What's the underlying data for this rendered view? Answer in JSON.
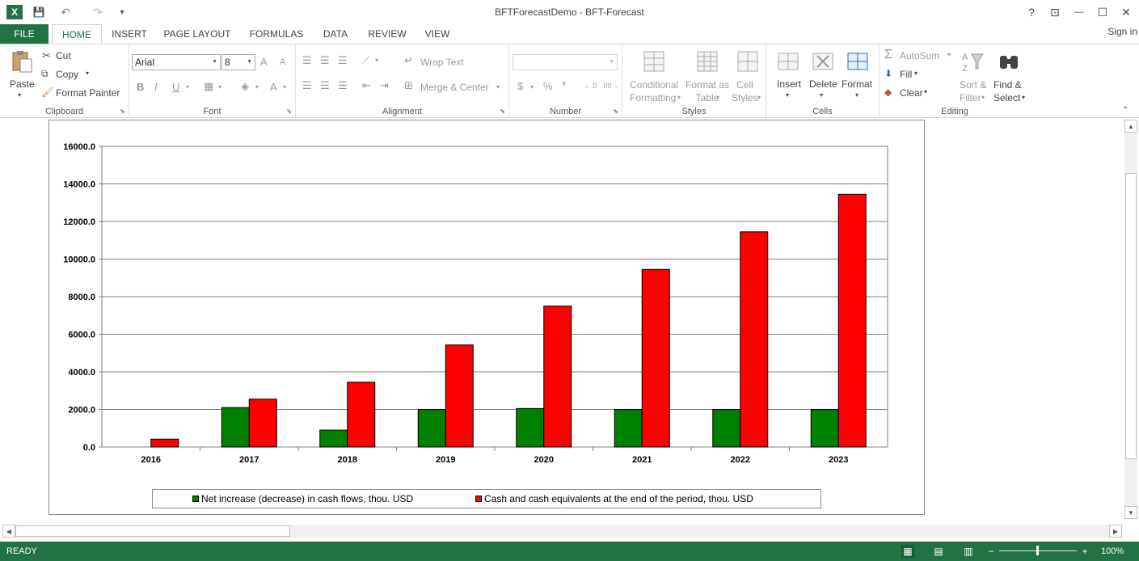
{
  "window": {
    "title": "BFTForecastDemo - BFT-Forecast",
    "help": "?",
    "ribbon_display": "⊡",
    "minimize": "—",
    "restore": "☐",
    "close": "✕"
  },
  "qat": {
    "excel": "X",
    "save": "💾",
    "undo": "↶",
    "redo": "↷",
    "customize": "▾"
  },
  "tabs": {
    "file": "FILE",
    "home": "HOME",
    "insert": "INSERT",
    "page_layout": "PAGE LAYOUT",
    "formulas": "FORMULAS",
    "data": "DATA",
    "review": "REVIEW",
    "view": "VIEW",
    "sign_in": "Sign in"
  },
  "ribbon": {
    "clipboard": {
      "label": "Clipboard",
      "paste": "Paste",
      "cut": "Cut",
      "copy": "Copy",
      "format_painter": "Format Painter"
    },
    "font": {
      "label": "Font",
      "font_name": "Arial",
      "font_size": "8",
      "grow": "A",
      "shrink": "A",
      "bold": "B",
      "italic": "I",
      "underline": "U",
      "font_color": "A"
    },
    "alignment": {
      "label": "Alignment",
      "wrap_text": "Wrap Text",
      "merge_center": "Merge & Center"
    },
    "number": {
      "label": "Number",
      "currency": "$",
      "percent": "%",
      "comma": "❜",
      "inc_decimal": "←.0",
      "dec_decimal": ".00→"
    },
    "styles": {
      "label": "Styles",
      "conditional_line1": "Conditional",
      "conditional_line2": "Formatting",
      "format_table_line1": "Format as",
      "format_table_line2": "Table",
      "cell_styles_line1": "Cell",
      "cell_styles_line2": "Styles"
    },
    "cells": {
      "label": "Cells",
      "insert": "Insert",
      "delete": "Delete",
      "format": "Format"
    },
    "editing": {
      "label": "Editing",
      "autosum": "AutoSum",
      "fill": "Fill",
      "clear": "Clear",
      "sort_line1": "Sort &",
      "sort_line2": "Filter",
      "find_line1": "Find &",
      "find_line2": "Select"
    }
  },
  "chart_data": {
    "type": "bar",
    "categories": [
      "2016",
      "2017",
      "2018",
      "2019",
      "2020",
      "2021",
      "2022",
      "2023"
    ],
    "series": [
      {
        "name": "Net increase (decrease) in cash flows, thou. USD",
        "color": "#008000",
        "values": [
          0,
          2100,
          900,
          2000,
          2050,
          2000,
          2000,
          2000
        ]
      },
      {
        "name": "Cash and cash equivalents at the end of the period, thou. USD",
        "color": "#ff0000",
        "values": [
          420,
          2550,
          3450,
          5430,
          7500,
          9450,
          11450,
          13450
        ]
      }
    ],
    "yticks": [
      "0.0",
      "2000.0",
      "4000.0",
      "6000.0",
      "8000.0",
      "10000.0",
      "12000.0",
      "14000.0",
      "16000.0"
    ],
    "ylim": [
      0,
      16000
    ],
    "grid": true,
    "legend_position": "bottom"
  },
  "status": {
    "ready": "READY",
    "zoom": "100%",
    "zoom_out": "−",
    "zoom_in": "+"
  }
}
